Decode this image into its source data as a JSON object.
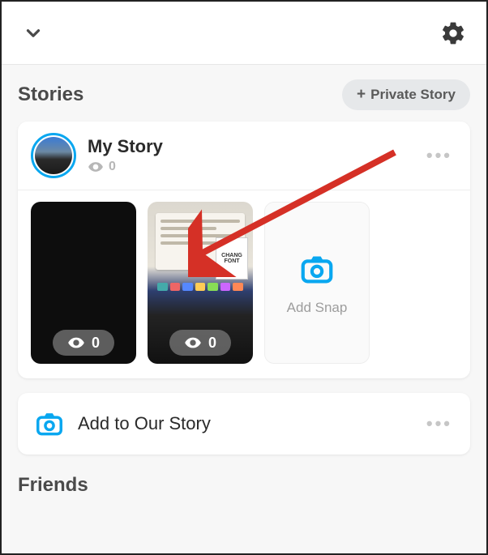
{
  "header": {
    "collapse_icon": "chevron-down",
    "settings_icon": "gear"
  },
  "stories_section": {
    "title": "Stories",
    "private_button_label": "Private Story",
    "private_button_plus": "+"
  },
  "my_story": {
    "title": "My Story",
    "view_count": "0",
    "more_label": "•••",
    "snaps": [
      {
        "kind": "dark",
        "views": "0"
      },
      {
        "kind": "photo",
        "views": "0",
        "book_text": "CHANG FONT"
      }
    ],
    "add_snap_label": "Add Snap"
  },
  "our_story": {
    "label": "Add to Our Story",
    "more_label": "•••"
  },
  "friends_section": {
    "title": "Friends"
  },
  "colors": {
    "accent": "#09a7f0",
    "arrow": "#d53026"
  }
}
